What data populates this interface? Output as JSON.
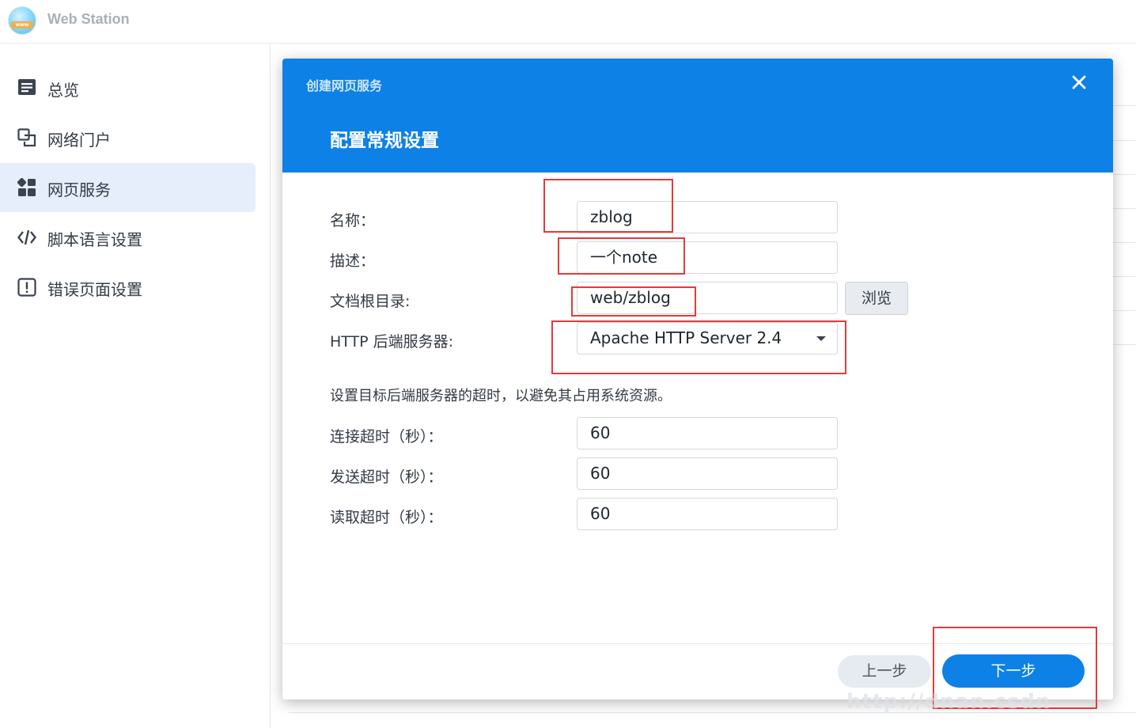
{
  "app": {
    "title": "Web Station",
    "logo_text": "www"
  },
  "sidebar": {
    "items": [
      {
        "label": "总览",
        "icon": "overview-icon",
        "active": false
      },
      {
        "label": "网络门户",
        "icon": "portal-icon",
        "active": false
      },
      {
        "label": "网页服务",
        "icon": "web-service-icon",
        "active": true
      },
      {
        "label": "脚本语言设置",
        "icon": "code-icon",
        "active": false
      },
      {
        "label": "错误页面设置",
        "icon": "error-icon",
        "active": false
      }
    ]
  },
  "dialog": {
    "caption": "创建网页服务",
    "heading": "配置常规设置",
    "close_icon": "close-icon",
    "fields": {
      "name": {
        "label": "名称：",
        "value": "zblog"
      },
      "description": {
        "label": "描述：",
        "value": "一个note"
      },
      "doc_root": {
        "label": "文档根目录:",
        "value": "web/zblog",
        "browse_label": "浏览"
      },
      "backend": {
        "label": "HTTP 后端服务器:",
        "value": "Apache HTTP Server 2.4"
      }
    },
    "timeout_info": "设置目标后端服务器的超时，以避免其占用系统资源。",
    "timeouts": {
      "connect": {
        "label": "连接超时（秒）：",
        "value": "60"
      },
      "send": {
        "label": "发送超时（秒）：",
        "value": "60"
      },
      "read": {
        "label": "读取超时（秒）：",
        "value": "60"
      }
    },
    "buttons": {
      "prev": "上一步",
      "next": "下一步"
    }
  },
  "watermark": "http://dnan.csdn",
  "colors": {
    "accent": "#0d81e6",
    "annotation": "#e23b3b",
    "active_nav_bg": "#e6eefb"
  }
}
